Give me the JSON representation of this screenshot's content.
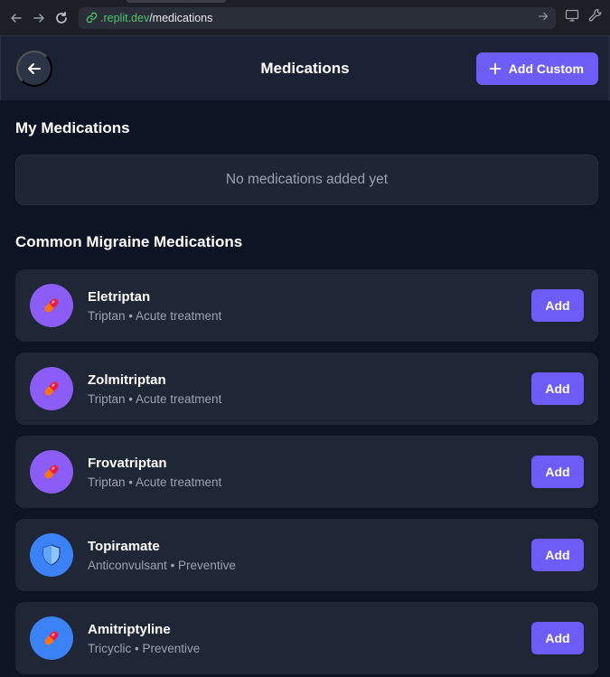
{
  "browser": {
    "url_host": ".replit.dev",
    "url_path": "/medications"
  },
  "header": {
    "title": "Medications",
    "add_custom_label": "Add Custom"
  },
  "my_medications": {
    "title": "My Medications",
    "empty_text": "No medications added yet"
  },
  "common": {
    "title": "Common Migraine Medications",
    "items": [
      {
        "name": "Eletriptan",
        "category": "Triptan",
        "use": "Acute treatment",
        "icon": "pill-icon",
        "color": "#8b5cf6",
        "add_label": "Add"
      },
      {
        "name": "Zolmitriptan",
        "category": "Triptan",
        "use": "Acute treatment",
        "icon": "pill-icon",
        "color": "#8b5cf6",
        "add_label": "Add"
      },
      {
        "name": "Frovatriptan",
        "category": "Triptan",
        "use": "Acute treatment",
        "icon": "pill-icon",
        "color": "#8b5cf6",
        "add_label": "Add"
      },
      {
        "name": "Topiramate",
        "category": "Anticonvulsant",
        "use": "Preventive",
        "icon": "shield-icon",
        "color": "#3b82f6",
        "add_label": "Add"
      },
      {
        "name": "Amitriptyline",
        "category": "Tricyclic",
        "use": "Preventive",
        "icon": "pill-icon",
        "color": "#3b82f6",
        "add_label": "Add"
      }
    ]
  },
  "separator": " • ",
  "colors": {
    "accent": "#6d5cf6",
    "background": "#0d1424",
    "card": "#1f2636"
  }
}
